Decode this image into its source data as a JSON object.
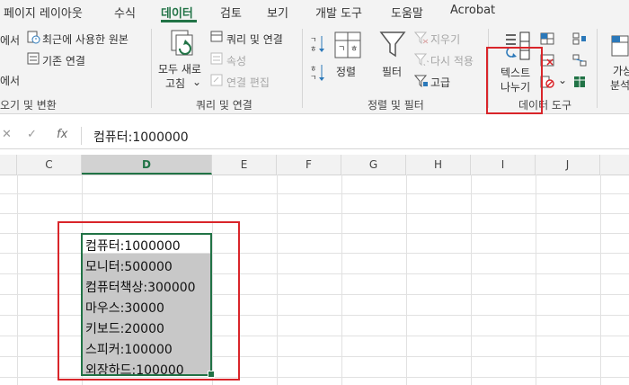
{
  "ribbon_tabs": [
    "페이지 레이아웃",
    "수식",
    "데이터",
    "검토",
    "보기",
    "개발 도구",
    "도움말",
    "Acrobat"
  ],
  "active_tab": "데이터",
  "get_data": {
    "item1": "에서",
    "item2": "에서",
    "recent_sources": "최근에 사용한 원본",
    "existing_connections": "기존 연결",
    "label": "오기 및 변환"
  },
  "queries": {
    "refresh_all_l1": "모두 새로",
    "refresh_all_l2": "고침",
    "queries_connections": "쿼리 및 연결",
    "properties": "속성",
    "edit_links": "연결 편집",
    "label": "쿼리 및 연결"
  },
  "sort_filter": {
    "sort": "정렬",
    "filter": "필터",
    "clear": "지우기",
    "reapply": "다시 적용",
    "advanced": "고급",
    "label": "정렬 및 필터"
  },
  "data_tools": {
    "text_to_columns_l1": "텍스트",
    "text_to_columns_l2": "나누기",
    "label": "데이터 도구"
  },
  "whatif": {
    "l1": "가상",
    "l2": "분석"
  },
  "formula_bar": {
    "fx": "fx",
    "cancel": "✕",
    "confirm": "✓",
    "value": "컴퓨터:1000000"
  },
  "columns": [
    "C",
    "D",
    "E",
    "F",
    "G",
    "H",
    "I",
    "J"
  ],
  "selected_column": "D",
  "cells": [
    "컴퓨터:1000000",
    "모니터:500000",
    "컴퓨터책상:300000",
    "마우스:30000",
    "키보드:20000",
    "스피커:100000",
    "외장하드:100000"
  ],
  "colors": {
    "accent": "#217346",
    "highlight": "#d9252a",
    "selection_fill": "#c8c8c8"
  }
}
